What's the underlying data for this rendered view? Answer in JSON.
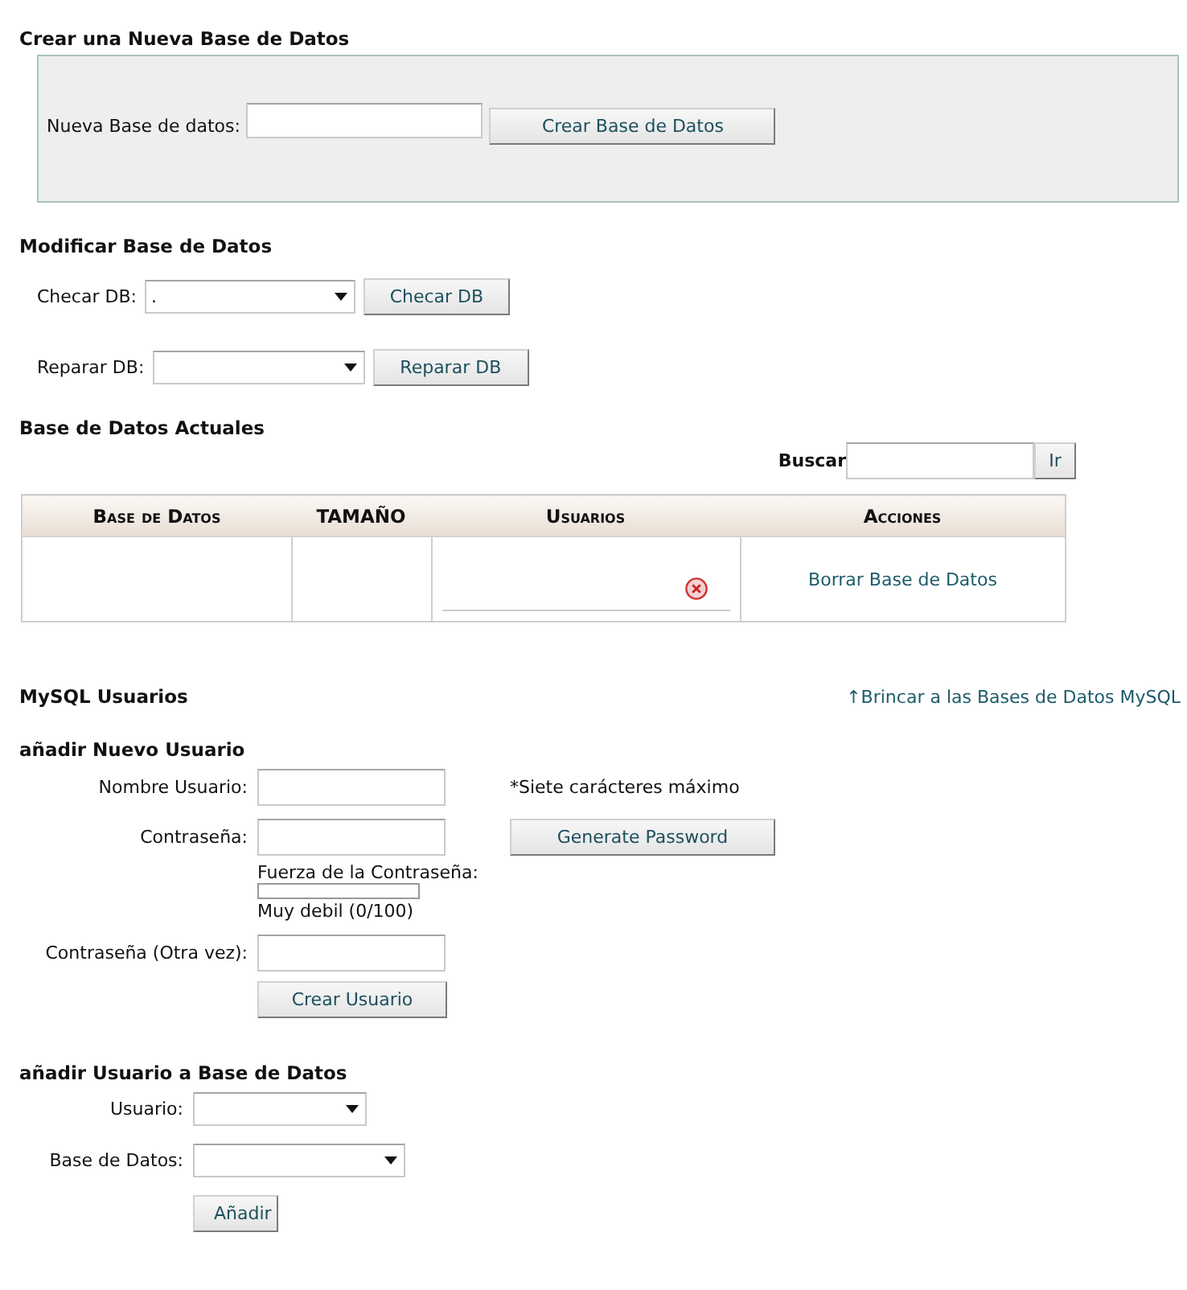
{
  "create_database": {
    "title": "Crear una Nueva Base de Datos",
    "label": "Nueva Base de datos:",
    "button": "Crear Base de Datos"
  },
  "modify_database": {
    "title": "Modificar Base de Datos",
    "rows": [
      {
        "label": "Checar DB:",
        "value": ".",
        "button": "Checar DB"
      },
      {
        "label": "Reparar DB:",
        "button": "Reparar DB"
      }
    ]
  },
  "current_databases": {
    "title": "Base de Datos Actuales",
    "search_label": "Buscar",
    "search_button": "Ir",
    "table": {
      "columns": [
        "Base de Datos",
        "TAMAÑO",
        "Usuarios",
        "Acciones"
      ],
      "rows": [
        {
          "actions": "Borrar Base de Datos"
        }
      ]
    }
  },
  "mysql_users": {
    "title": "MySQL Usuarios",
    "jump_link": "↑Brincar a las Bases de Datos MySQL"
  },
  "add_user": {
    "title": "añadir Nuevo Usuario",
    "username_label": "Nombre Usuario:",
    "username_note": "*Siete carácteres máximo",
    "password_label": "Contraseña:",
    "generate_button": "Generate Password",
    "strength_label": "Fuerza de la Contraseña:",
    "strength": {
      "level": 0
    },
    "strength_text": "Muy debil (0/100)",
    "password_again_label": "Contraseña (Otra vez):",
    "create_button": "Crear Usuario"
  },
  "add_user_to_database": {
    "title": "añadir Usuario a Base de Datos",
    "fields": [
      {
        "label": "Usuario:"
      },
      {
        "label": "Base de Datos:"
      }
    ],
    "button": "Añadir"
  }
}
